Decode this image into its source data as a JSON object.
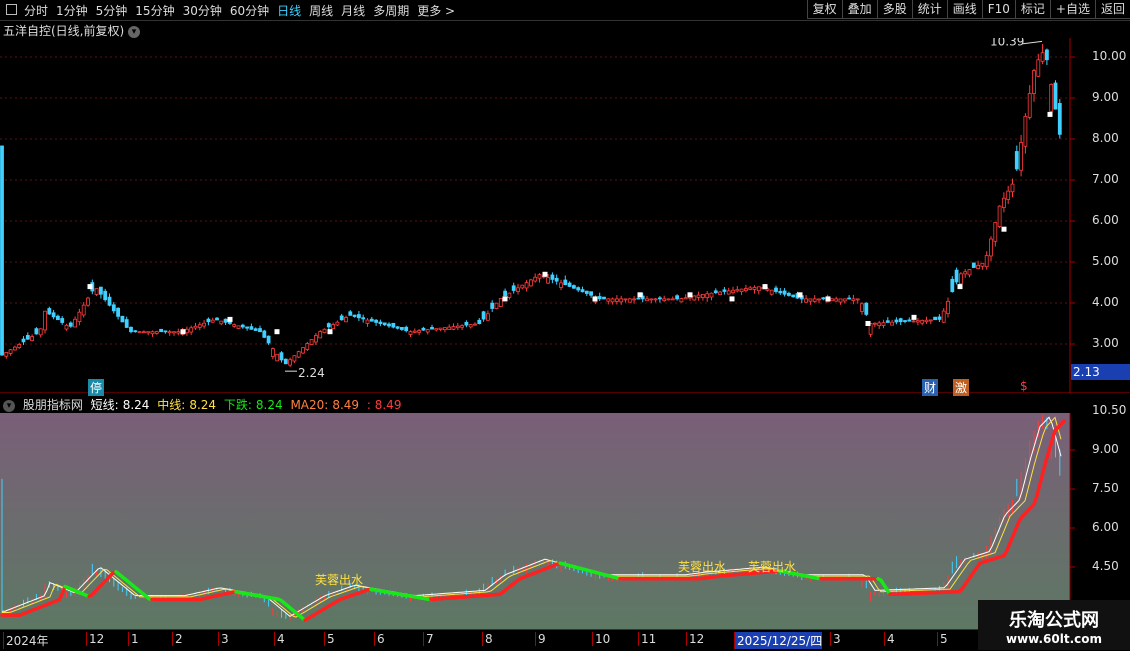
{
  "toolbar": {
    "periods": [
      "分时",
      "1分钟",
      "5分钟",
      "15分钟",
      "30分钟",
      "60分钟",
      "日线",
      "周线",
      "月线",
      "多周期",
      "更多 >"
    ],
    "active_period": "日线",
    "right_buttons": [
      "复权",
      "叠加",
      "多股",
      "统计",
      "画线",
      "F10",
      "标记",
      "+自选",
      "返回"
    ]
  },
  "stock": {
    "title": "五洋自控(日线,前复权)",
    "high_marker": "10.39",
    "low_marker": "2.24",
    "current_price": "2.13"
  },
  "price_axis": [
    "10.00",
    "9.00",
    "8.00",
    "7.00",
    "6.00",
    "5.00",
    "4.00",
    "3.00"
  ],
  "signals": {
    "stop": "停",
    "fin": "财",
    "excite": "激",
    "dollar": "$"
  },
  "indicator": {
    "name": "股朋指标网",
    "short_label": "短线:",
    "short_value": "8.24",
    "mid_label": "中线:",
    "mid_value": "8.24",
    "down_label": "下跌:",
    "down_value": "8.24",
    "ma_label": "MA20:",
    "ma_value": "8.49",
    "extra_value": ": 8.49",
    "annotations": [
      "芙蓉出水",
      "芙蓉出水",
      "芙蓉出水"
    ]
  },
  "indicator_axis": [
    "10.50",
    "9.00",
    "7.50",
    "6.00",
    "4.50"
  ],
  "x_axis": [
    "2024年",
    "12",
    "1",
    "2",
    "3",
    "4",
    "5",
    "6",
    "7",
    "8",
    "9",
    "10",
    "11",
    "12",
    "2025/12/25/四",
    "3",
    "4",
    "5"
  ],
  "watermark": {
    "line1": "乐淘公式网",
    "line2": "www.60lt.com"
  },
  "colors": {
    "up": "#ff3c3c",
    "down": "#3fd0ff",
    "ma_red": "#ff2020",
    "ma_green": "#18e818",
    "line_yellow": "#ffe040",
    "line_white": "#ffffff"
  },
  "chart_data": {
    "type": "line",
    "title": "五洋自控(日线,前复权)",
    "x": [
      "2024年",
      "12",
      "1",
      "2",
      "3",
      "4",
      "5",
      "6",
      "7",
      "8",
      "9",
      "10",
      "11",
      "12",
      "2025/12/25/四",
      "3",
      "4",
      "5"
    ],
    "series": [
      {
        "name": "",
        "values": [
          2.6,
          3.4,
          3.3,
          3.0,
          3.4,
          2.5,
          3.4,
          3.6,
          3.6,
          4.0,
          4.7,
          4.1,
          4.1,
          4.3,
          4.2,
          3.6,
          4.4,
          10.3
        ]
      }
    ],
    "ylim": [
      2.0,
      10.5
    ]
  }
}
